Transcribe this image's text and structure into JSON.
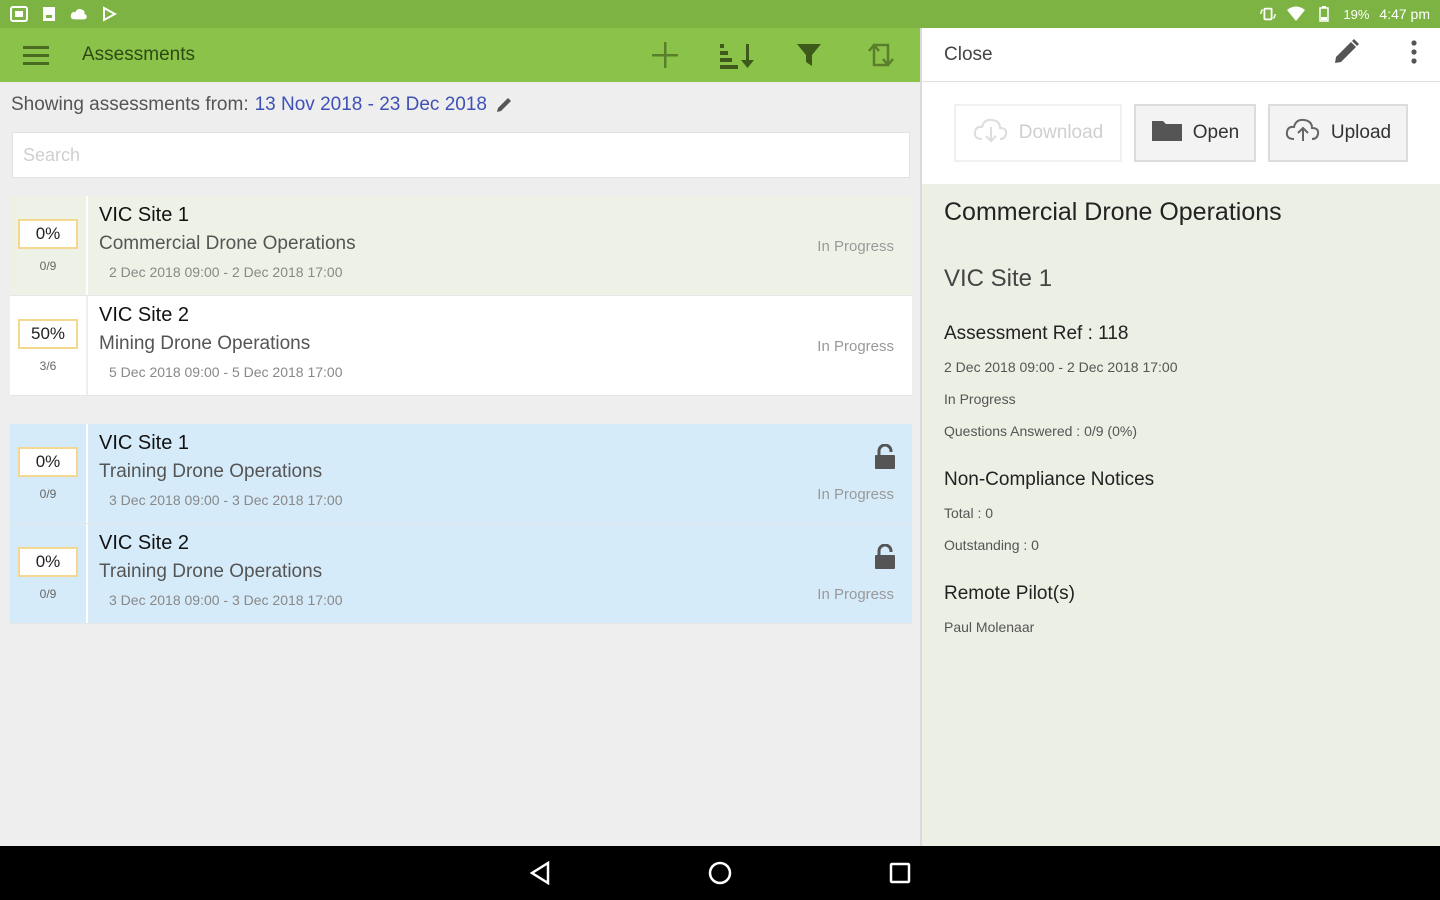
{
  "statusbar": {
    "battery": "19%",
    "time": "4:47 pm"
  },
  "appbar": {
    "title": "Assessments"
  },
  "filter": {
    "prefix": "Showing assessments from:",
    "dates": "13 Nov 2018 - 23 Dec 2018"
  },
  "search": {
    "placeholder": "Search"
  },
  "assessments": [
    {
      "percent": "0%",
      "ratio": "0/9",
      "site": "VIC Site 1",
      "operation": "Commercial Drone Operations",
      "when": "2 Dec 2018 09:00 - 2 Dec 2018 17:00",
      "status": "In Progress"
    },
    {
      "percent": "50%",
      "ratio": "3/6",
      "site": "VIC Site 2",
      "operation": "Mining Drone Operations",
      "when": "5 Dec 2018 09:00 - 5 Dec 2018 17:00",
      "status": "In Progress"
    }
  ],
  "locked_assessments": [
    {
      "percent": "0%",
      "ratio": "0/9",
      "site": "VIC Site 1",
      "operation": "Training Drone Operations",
      "when": "3 Dec 2018 09:00 - 3 Dec 2018 17:00",
      "status": "In Progress"
    },
    {
      "percent": "0%",
      "ratio": "0/9",
      "site": "VIC Site 2",
      "operation": "Training Drone Operations",
      "when": "3 Dec 2018 09:00 - 3 Dec 2018 17:00",
      "status": "In Progress"
    }
  ],
  "detail_bar": {
    "close_label": "Close"
  },
  "actions": {
    "download": "Download",
    "open": "Open",
    "upload": "Upload"
  },
  "detail": {
    "title": "Commercial Drone Operations",
    "site": "VIC Site 1",
    "ref": "Assessment Ref : 118",
    "when": "2 Dec 2018 09:00 - 2 Dec 2018 17:00",
    "status": "In Progress",
    "questions": "Questions Answered : 0/9 (0%)",
    "ncn_heading": "Non-Compliance Notices",
    "ncn_total": "Total : 0",
    "ncn_outstanding": "Outstanding : 0",
    "pilots_heading": "Remote Pilot(s)",
    "pilot": "Paul Molenaar"
  },
  "colors": {
    "statusbar": "#7cb342",
    "appbar": "#8bc34a",
    "link": "#3f51b5",
    "locked_row": "#d6ebfa",
    "selected_row": "#eef2e6"
  }
}
